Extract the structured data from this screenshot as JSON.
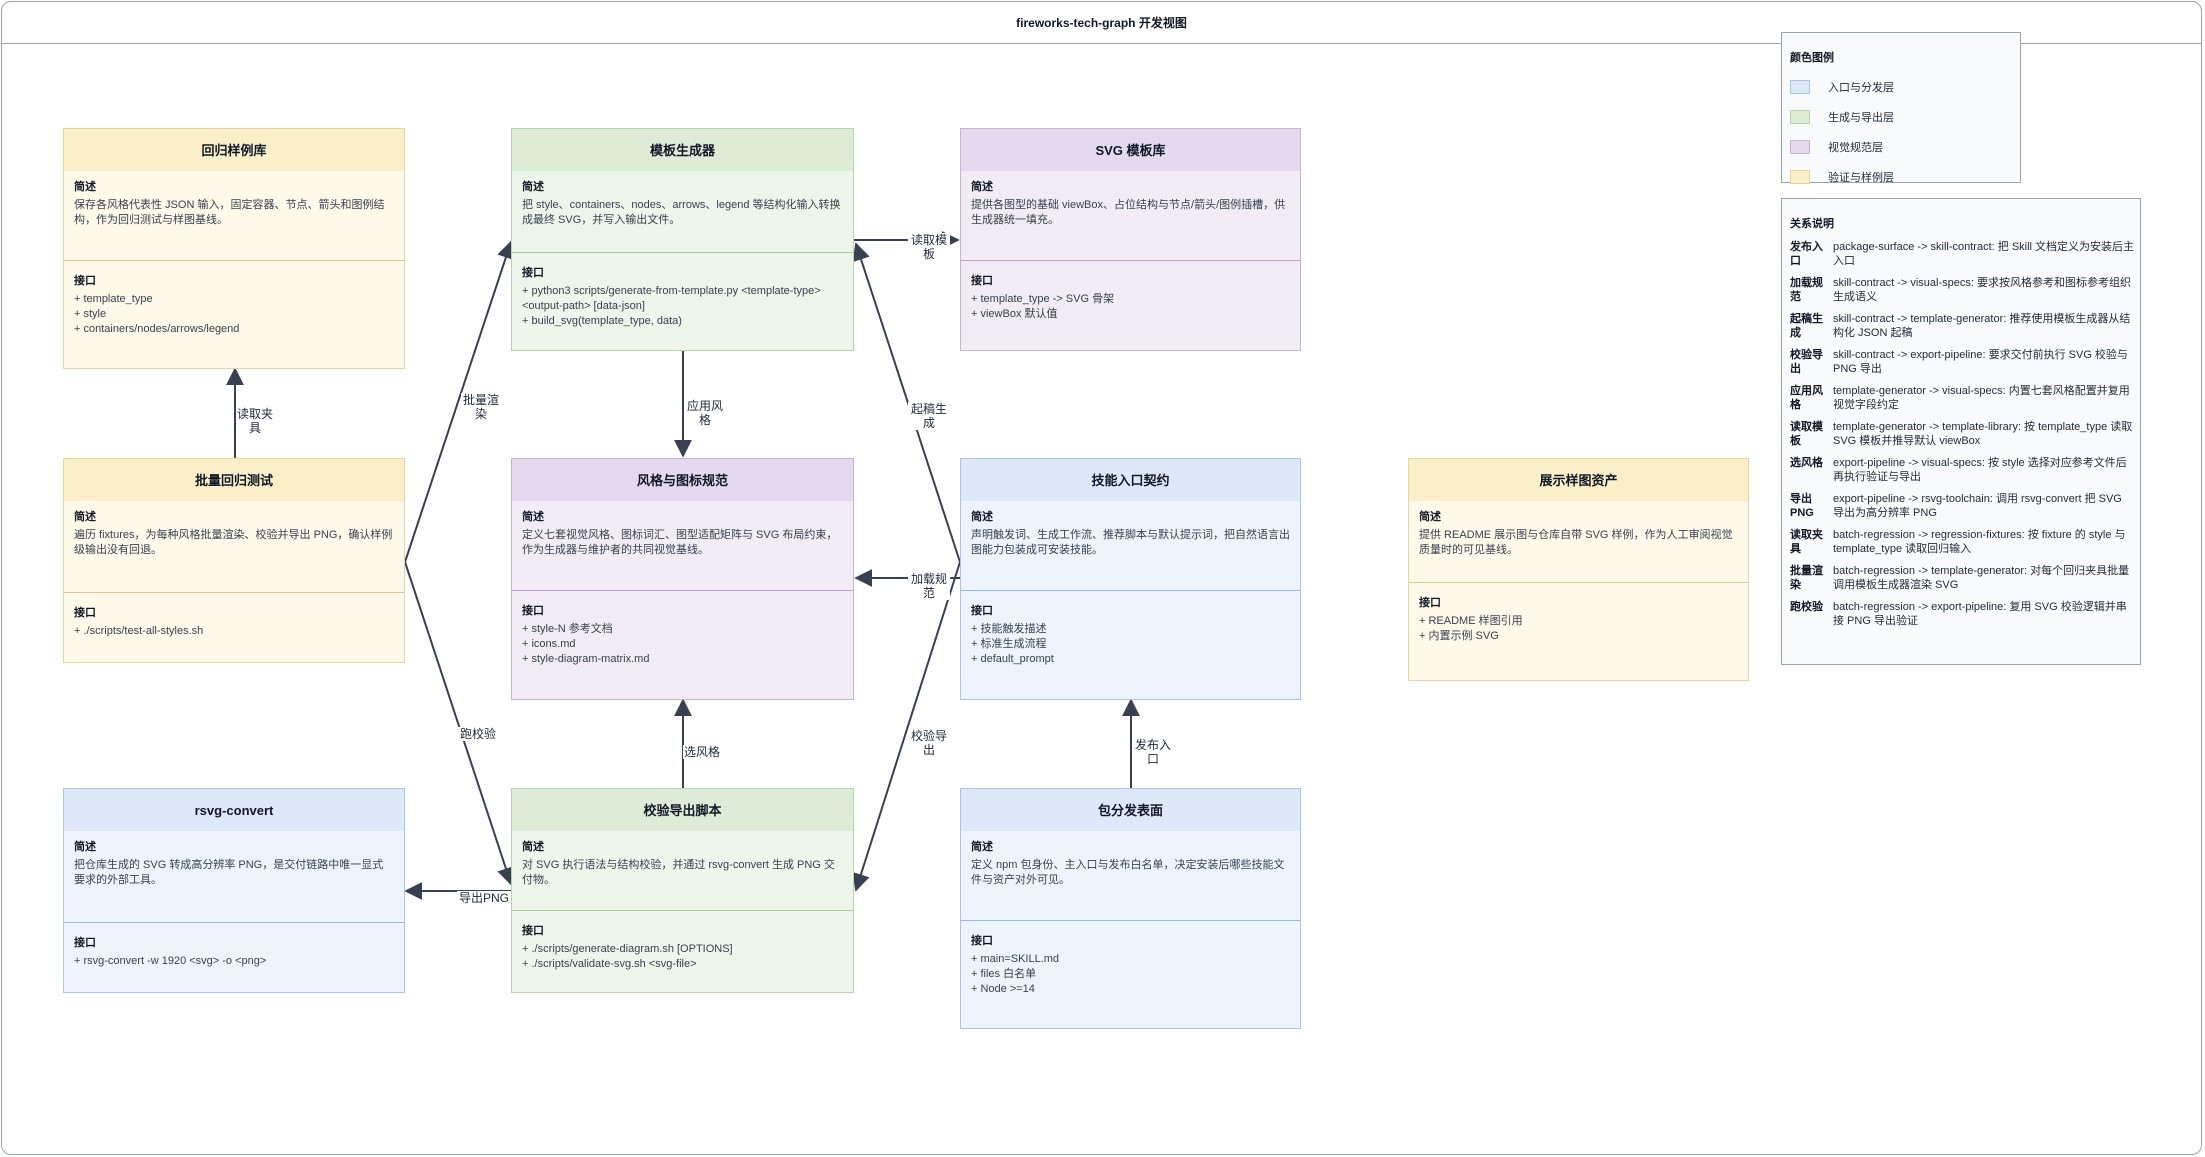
{
  "title": "fireworks-tech-graph 开发视图",
  "section_titles": {
    "desc": "简述",
    "iface": "接口"
  },
  "colors": {
    "blue": "#dde8f8",
    "green": "#dcecd7",
    "purple": "#e4d9ee",
    "yellow": "#fbefc9",
    "edge": "#374151"
  },
  "nodes": {
    "regression_fixtures": {
      "title": "回归样例库",
      "desc": "保存各风格代表性 JSON 输入，固定容器、节点、箭头和图例结构，作为回归测试与样图基线。",
      "items": [
        "+ template_type",
        "+ style",
        "+ containers/nodes/arrows/legend"
      ]
    },
    "template_generator": {
      "title": "模板生成器",
      "desc": "把 style、containers、nodes、arrows、legend 等结构化输入转换成最终 SVG，并写入输出文件。",
      "items": [
        "+ python3 scripts/generate-from-template.py <template-type> <output-path> [data-json]",
        "+ build_svg(template_type, data)"
      ]
    },
    "template_library": {
      "title": "SVG 模板库",
      "desc": "提供各图型的基础 viewBox、占位结构与节点/箭头/图例插槽，供生成器统一填充。",
      "items": [
        "+ template_type -> SVG 骨架",
        "+ viewBox 默认值"
      ]
    },
    "batch_regression": {
      "title": "批量回归测试",
      "desc": "遍历 fixtures，为每种风格批量渲染、校验并导出 PNG，确认样例级输出没有回退。",
      "items": [
        "+ ./scripts/test-all-styles.sh"
      ]
    },
    "visual_specs": {
      "title": "风格与图标规范",
      "desc": "定义七套视觉风格、图标词汇、图型适配矩阵与 SVG 布局约束，作为生成器与维护者的共同视觉基线。",
      "items": [
        "+ style-N 参考文档",
        "+ icons.md",
        "+ style-diagram-matrix.md"
      ]
    },
    "skill_contract": {
      "title": "技能入口契约",
      "desc": "声明触发词、生成工作流、推荐脚本与默认提示词，把自然语言出图能力包装成可安装技能。",
      "items": [
        "+ 技能触发描述",
        "+ 标准生成流程",
        "+ default_prompt"
      ]
    },
    "showcase_assets": {
      "title": "展示样图资产",
      "desc": "提供 README 展示图与仓库自带 SVG 样例，作为人工审阅视觉质量时的可见基线。",
      "items": [
        "+ README 样图引用",
        "+ 内置示例 SVG"
      ]
    },
    "rsvg_toolchain": {
      "title": "rsvg-convert",
      "desc": "把仓库生成的 SVG 转成高分辨率 PNG，是交付链路中唯一显式要求的外部工具。",
      "items": [
        "+ rsvg-convert -w 1920 <svg> -o <png>"
      ]
    },
    "export_pipeline": {
      "title": "校验导出脚本",
      "desc": "对 SVG 执行语法与结构校验，并通过 rsvg-convert 生成 PNG 交付物。",
      "items": [
        "+ ./scripts/generate-diagram.sh [OPTIONS]",
        "+ ./scripts/validate-svg.sh <svg-file>"
      ]
    },
    "package_surface": {
      "title": "包分发表面",
      "desc": "定义 npm 包身份、主入口与发布白名单，决定安装后哪些技能文件与资产对外可见。",
      "items": [
        "+ main=SKILL.md",
        "+ files 白名单",
        "+ Node >=14"
      ]
    }
  },
  "edge_labels": {
    "read_fixture": "读取夹\n具",
    "batch_render": "批量渲\n染",
    "apply_style": "应用风\n格",
    "read_template": "读取模\n板",
    "draft_generate": "起稿生\n成",
    "load_spec": "加载规\n范",
    "run_validate": "跑校验",
    "select_style": "选风格",
    "validate_export": "校验导\n出",
    "publish_entry": "发布入\n口",
    "export_png": "导出PNG"
  },
  "legend": {
    "title": "颜色图例",
    "items": [
      {
        "label": "入口与分发层",
        "color": "#dde8f8",
        "border": "#a8c3ec"
      },
      {
        "label": "生成与导出层",
        "color": "#dcecd7",
        "border": "#b4d6ad"
      },
      {
        "label": "视觉规范层",
        "color": "#e4d9ee",
        "border": "#c6b3d6"
      },
      {
        "label": "验证与样例层",
        "color": "#fbefc9",
        "border": "#e7d6a0"
      }
    ]
  },
  "relations": {
    "title": "关系说明",
    "items": [
      {
        "k": "发布入口",
        "v": "package-surface -> skill-contract: 把 Skill 文档定义为安装后主入口"
      },
      {
        "k": "加载规范",
        "v": "skill-contract -> visual-specs: 要求按风格参考和图标参考组织生成语义"
      },
      {
        "k": "起稿生成",
        "v": "skill-contract -> template-generator: 推荐使用模板生成器从结构化 JSON 起稿"
      },
      {
        "k": "校验导出",
        "v": "skill-contract -> export-pipeline: 要求交付前执行 SVG 校验与 PNG 导出"
      },
      {
        "k": "应用风格",
        "v": "template-generator -> visual-specs: 内置七套风格配置并复用视觉字段约定"
      },
      {
        "k": "读取模板",
        "v": "template-generator -> template-library: 按 template_type 读取 SVG 模板并推导默认 viewBox"
      },
      {
        "k": "选风格",
        "v": "export-pipeline -> visual-specs: 按 style 选择对应参考文件后再执行验证与导出"
      },
      {
        "k": "导出PNG",
        "v": "export-pipeline -> rsvg-toolchain: 调用 rsvg-convert 把 SVG 导出为高分辨率 PNG"
      },
      {
        "k": "读取夹具",
        "v": "batch-regression -> regression-fixtures: 按 fixture 的 style 与 template_type 读取回归输入"
      },
      {
        "k": "批量渲染",
        "v": "batch-regression -> template-generator: 对每个回归夹具批量调用模板生成器渲染 SVG"
      },
      {
        "k": "跑校验",
        "v": "batch-regression -> export-pipeline: 复用 SVG 校验逻辑并串接 PNG 导出验证"
      }
    ]
  }
}
